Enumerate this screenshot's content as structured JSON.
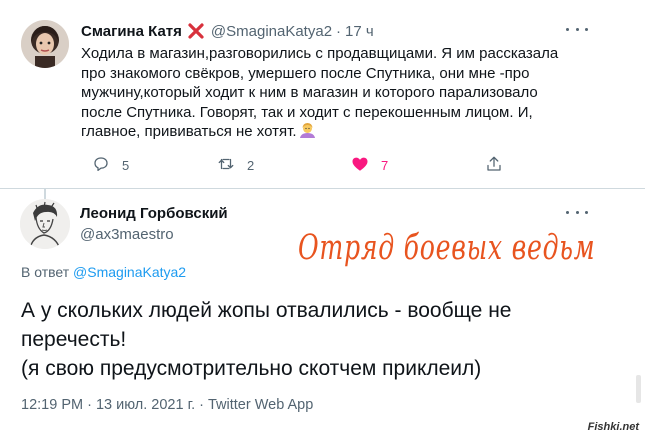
{
  "tweet": {
    "author_name": "Смагина Катя",
    "author_badge_icon": "cross-mark-icon",
    "author_handle": "@SmaginaKatya2",
    "separator": "·",
    "time": "17 ч",
    "text_lines": [
      "Ходила в магазин,разговорились с продавщицами. Я им рассказала",
      "про знакомого свёкров, умершего после Спутника, они мне -про",
      "мужчину,который ходит к ним в магазин и которого парализовало",
      "после Спутника. Говорят, так и ходит с перекошенным лицом. И,",
      "главное, прививаться не хотят."
    ],
    "trailing_emoji": "woman-shrugging-emoji",
    "replies": "5",
    "retweets": "2",
    "likes": "7",
    "like_color": "#f91880"
  },
  "reply": {
    "author_name": "Леонид Горбовский",
    "author_handle": "@ax3maestro",
    "reply_to_prefix": "В ответ",
    "reply_to_handle": "@SmaginaKatya2",
    "text_lines": [
      "А у скольких людей жопы отвалились - вообще не",
      "перечесть!",
      "(я свою предусмотрительно скотчем приклеил)"
    ],
    "meta": "12:19 PM · 13 июл. 2021 г. · Twitter Web App"
  },
  "overlay_caption": "Отряд боевых ведьм",
  "watermark": "Fishki.net",
  "colors": {
    "link": "#1d9bf0",
    "secondary_text": "#536471",
    "caption": "#e8541f"
  }
}
